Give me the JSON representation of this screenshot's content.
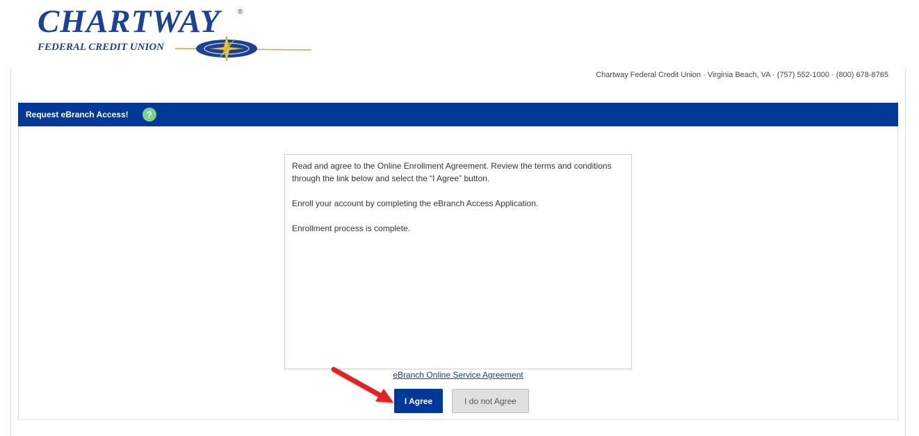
{
  "brand": {
    "name": "Chartway",
    "registered_mark": "®",
    "subtitle": "FEDERAL CREDIT UNION"
  },
  "contact": {
    "line": "Chartway Federal Credit Union · Virginia Beach, VA · (757) 552-1000 · (800) 678-8765"
  },
  "header": {
    "title": "Request eBranch Access!",
    "help_icon": "question-icon",
    "help_symbol": "?"
  },
  "info": {
    "paragraphs": [
      "Read and agree to the Online Enrollment Agreement. Review the terms and conditions through the link below and select the “I Agree” button.",
      "Enroll your account by completing the eBranch Access Application.",
      "Enrollment process is complete."
    ]
  },
  "agreement_link": "eBranch Online Service Agreement",
  "buttons": {
    "agree": "I Agree",
    "disagree": "I do not Agree"
  },
  "colors": {
    "brand_blue": "#023996",
    "help_green": "#7dcf8d",
    "arrow_red": "#e02020"
  }
}
